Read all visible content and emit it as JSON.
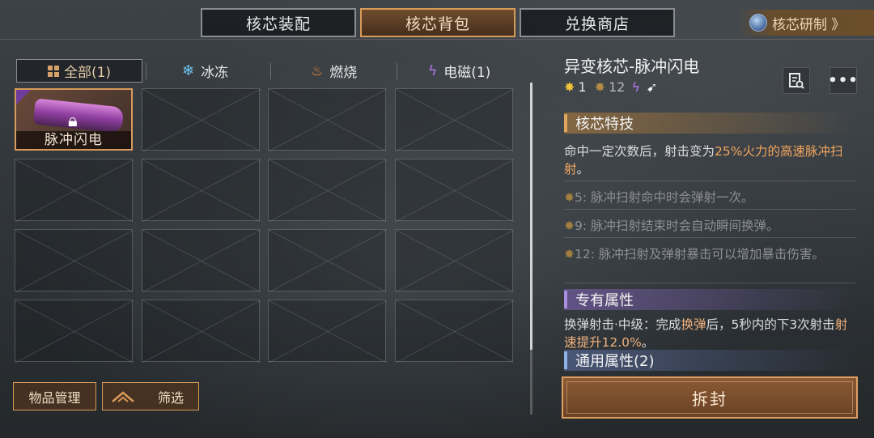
{
  "tabs": [
    {
      "label": "核芯装配",
      "active": false
    },
    {
      "label": "核芯背包",
      "active": true
    },
    {
      "label": "兑换商店",
      "active": false
    }
  ],
  "research": {
    "label": "核芯研制 》",
    "icon": "core-gem-icon"
  },
  "filters": {
    "all": "全部(1)",
    "ice": "冰冻",
    "fire": "燃烧",
    "elec": "电磁(1)"
  },
  "inventory": {
    "item_name": "脉冲闪电",
    "rows": 4,
    "cols": 4
  },
  "buttons": {
    "manage": "物品管理",
    "filter": "筛选",
    "unseal": "拆封"
  },
  "detail": {
    "title": "异变核芯-脉冲闪电",
    "star_count_a": "1",
    "star_count_b": "12",
    "skill_header": "核芯特技",
    "skill_desc_pre": "命中一定次数后，射击变为",
    "skill_desc_hl": "25%火力的高速脉冲扫射",
    "skill_desc_post": "。",
    "tiers": [
      {
        "n": "5",
        "text": ": 脉冲扫射命中时会弹射一次。"
      },
      {
        "n": "9",
        "text": ": 脉冲扫射结束时会自动瞬间换弹。"
      },
      {
        "n": "12",
        "text": ": 脉冲扫射及弹射暴击可以增加暴击伤害。"
      }
    ],
    "exclusive_header": "专有属性",
    "exclusive_pre": "换弹射击·中级：完成",
    "exclusive_hl1": "换弹",
    "exclusive_mid": "后，5秒内的下3次射击",
    "exclusive_hl2": "射速提升12.0%",
    "exclusive_post": "。",
    "general_header": "通用属性(2)"
  },
  "colors": {
    "accent": "#d89a5a",
    "highlight": "#f2a55e",
    "star": "#f3c33d",
    "electric": "#b27af2"
  }
}
